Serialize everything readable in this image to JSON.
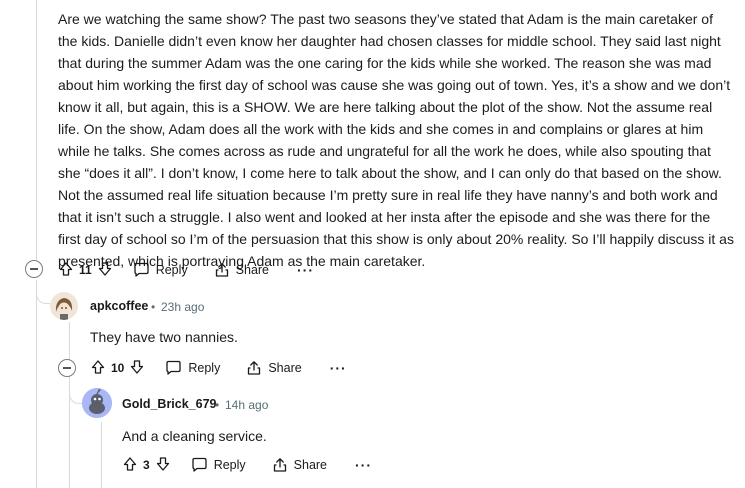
{
  "main_comment": {
    "text": "Are we watching the same show? The past two seasons they’ve stated that Adam is the main caretaker of the kids. Danielle didn’t even know her daughter had chosen classes for middle school. They said last night that during the summer Adam was the one caring for the kids while she worked. The reason she was mad about him working the first day of school was cause she was going out of town. Yes, it’s a show and we don’t know it all, but again, this is a SHOW. We are here talking about the plot of the show. Not the assume real life. On the show, Adam does all the work with the kids and she comes in and complains or glares at him while he talks. She comes across as rude and ungrateful for all the work he does, while also spouting that she “does it all”. I don’t know, I come here to talk about the show, and I can only do that based on the show. Not the assumed real life situation because I’m pretty sure in real life they have nanny’s and both work and that it isn’t such a struggle. I also went and looked at her insta after the episode and she was there for the first day of school so I’m of the persuasion that this show is only about 20% reality. So I’ll happily discuss it as presented, which is portraying Adam as the main caretaker.",
    "votes": "11",
    "reply_label": "Reply",
    "share_label": "Share",
    "more_label": "···"
  },
  "reply_1": {
    "username": "apkcoffee",
    "separator": "•",
    "time": "23h ago",
    "text": "They have two nannies.",
    "votes": "10",
    "reply_label": "Reply",
    "share_label": "Share",
    "more_label": "···"
  },
  "reply_2": {
    "username": "Gold_Brick_679",
    "separator": "•",
    "time": "14h ago",
    "text": "And a cleaning service.",
    "votes": "3",
    "reply_label": "Reply",
    "share_label": "Share",
    "more_label": "···"
  },
  "colors": {
    "thread_line": "#d7dadc",
    "avatar2_bg": "#a9b8f5",
    "meta_text": "#576f76"
  },
  "icons": [
    "upvote-icon",
    "downvote-icon",
    "comment-icon",
    "share-icon",
    "collapse-icon",
    "more-icon"
  ]
}
